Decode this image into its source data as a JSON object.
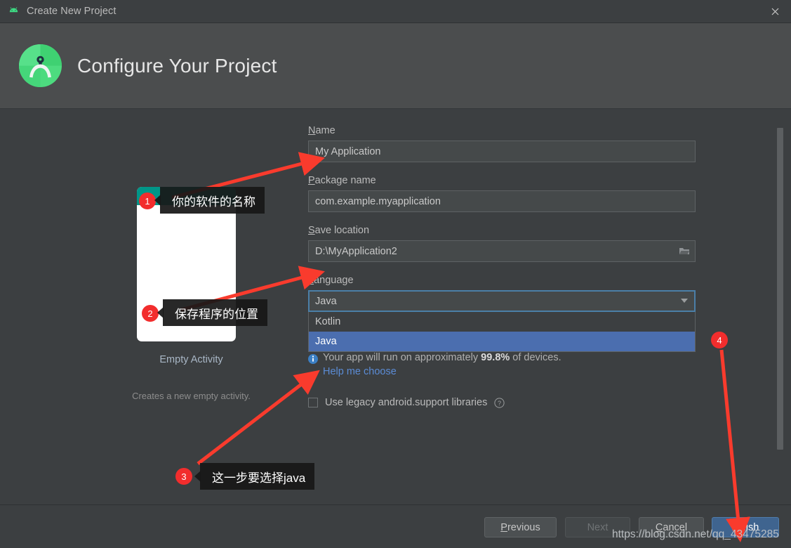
{
  "window": {
    "title": "Create New Project",
    "app_icon": "android-icon",
    "close_icon": "close-icon"
  },
  "header": {
    "title": "Configure Your Project",
    "logo_icon": "android-studio-logo"
  },
  "preview": {
    "template_name": "Empty Activity",
    "template_description": "Creates a new empty activity.",
    "appbar_color": "#009688"
  },
  "form": {
    "name": {
      "label_mnemonic": "N",
      "label_rest": "ame",
      "value": "My Application"
    },
    "package": {
      "label_mnemonic": "P",
      "label_rest": "ackage name",
      "value": "com.example.myapplication"
    },
    "save_location": {
      "label_mnemonic": "S",
      "label_rest": "ave location",
      "value": "D:\\MyApplication2",
      "browse_icon": "folder-icon"
    },
    "language": {
      "label_mnemonic": "L",
      "label_rest": "anguage",
      "value": "Java",
      "dropdown_open": true,
      "options": [
        "Kotlin",
        "Java"
      ],
      "selected_index": 1
    },
    "info": {
      "icon": "info-icon",
      "text_before": "Your app will run on approximately ",
      "percent": "99.8%",
      "text_after": " of devices.",
      "link": "Help me choose"
    },
    "legacy": {
      "label": "Use legacy android.support libraries",
      "checked": false,
      "help_icon": "question-circle-icon"
    }
  },
  "footer": {
    "previous": {
      "mnemonic": "P",
      "rest": "revious"
    },
    "next": {
      "label": "Next",
      "disabled": true
    },
    "cancel": {
      "mnemonic": "C",
      "rest": "ancel"
    },
    "finish": {
      "mnemonic": "i",
      "before": "F",
      "rest": "nish"
    }
  },
  "annotations": {
    "items": [
      {
        "number": "1",
        "text": "你的软件的名称"
      },
      {
        "number": "2",
        "text": "保存程序的位置"
      },
      {
        "number": "3",
        "text": "这一步要选择java"
      },
      {
        "number": "4",
        "text": ""
      }
    ],
    "accent_color": "#f22d2d"
  },
  "watermark": "https://blog.csdn.net/qq_43475285"
}
